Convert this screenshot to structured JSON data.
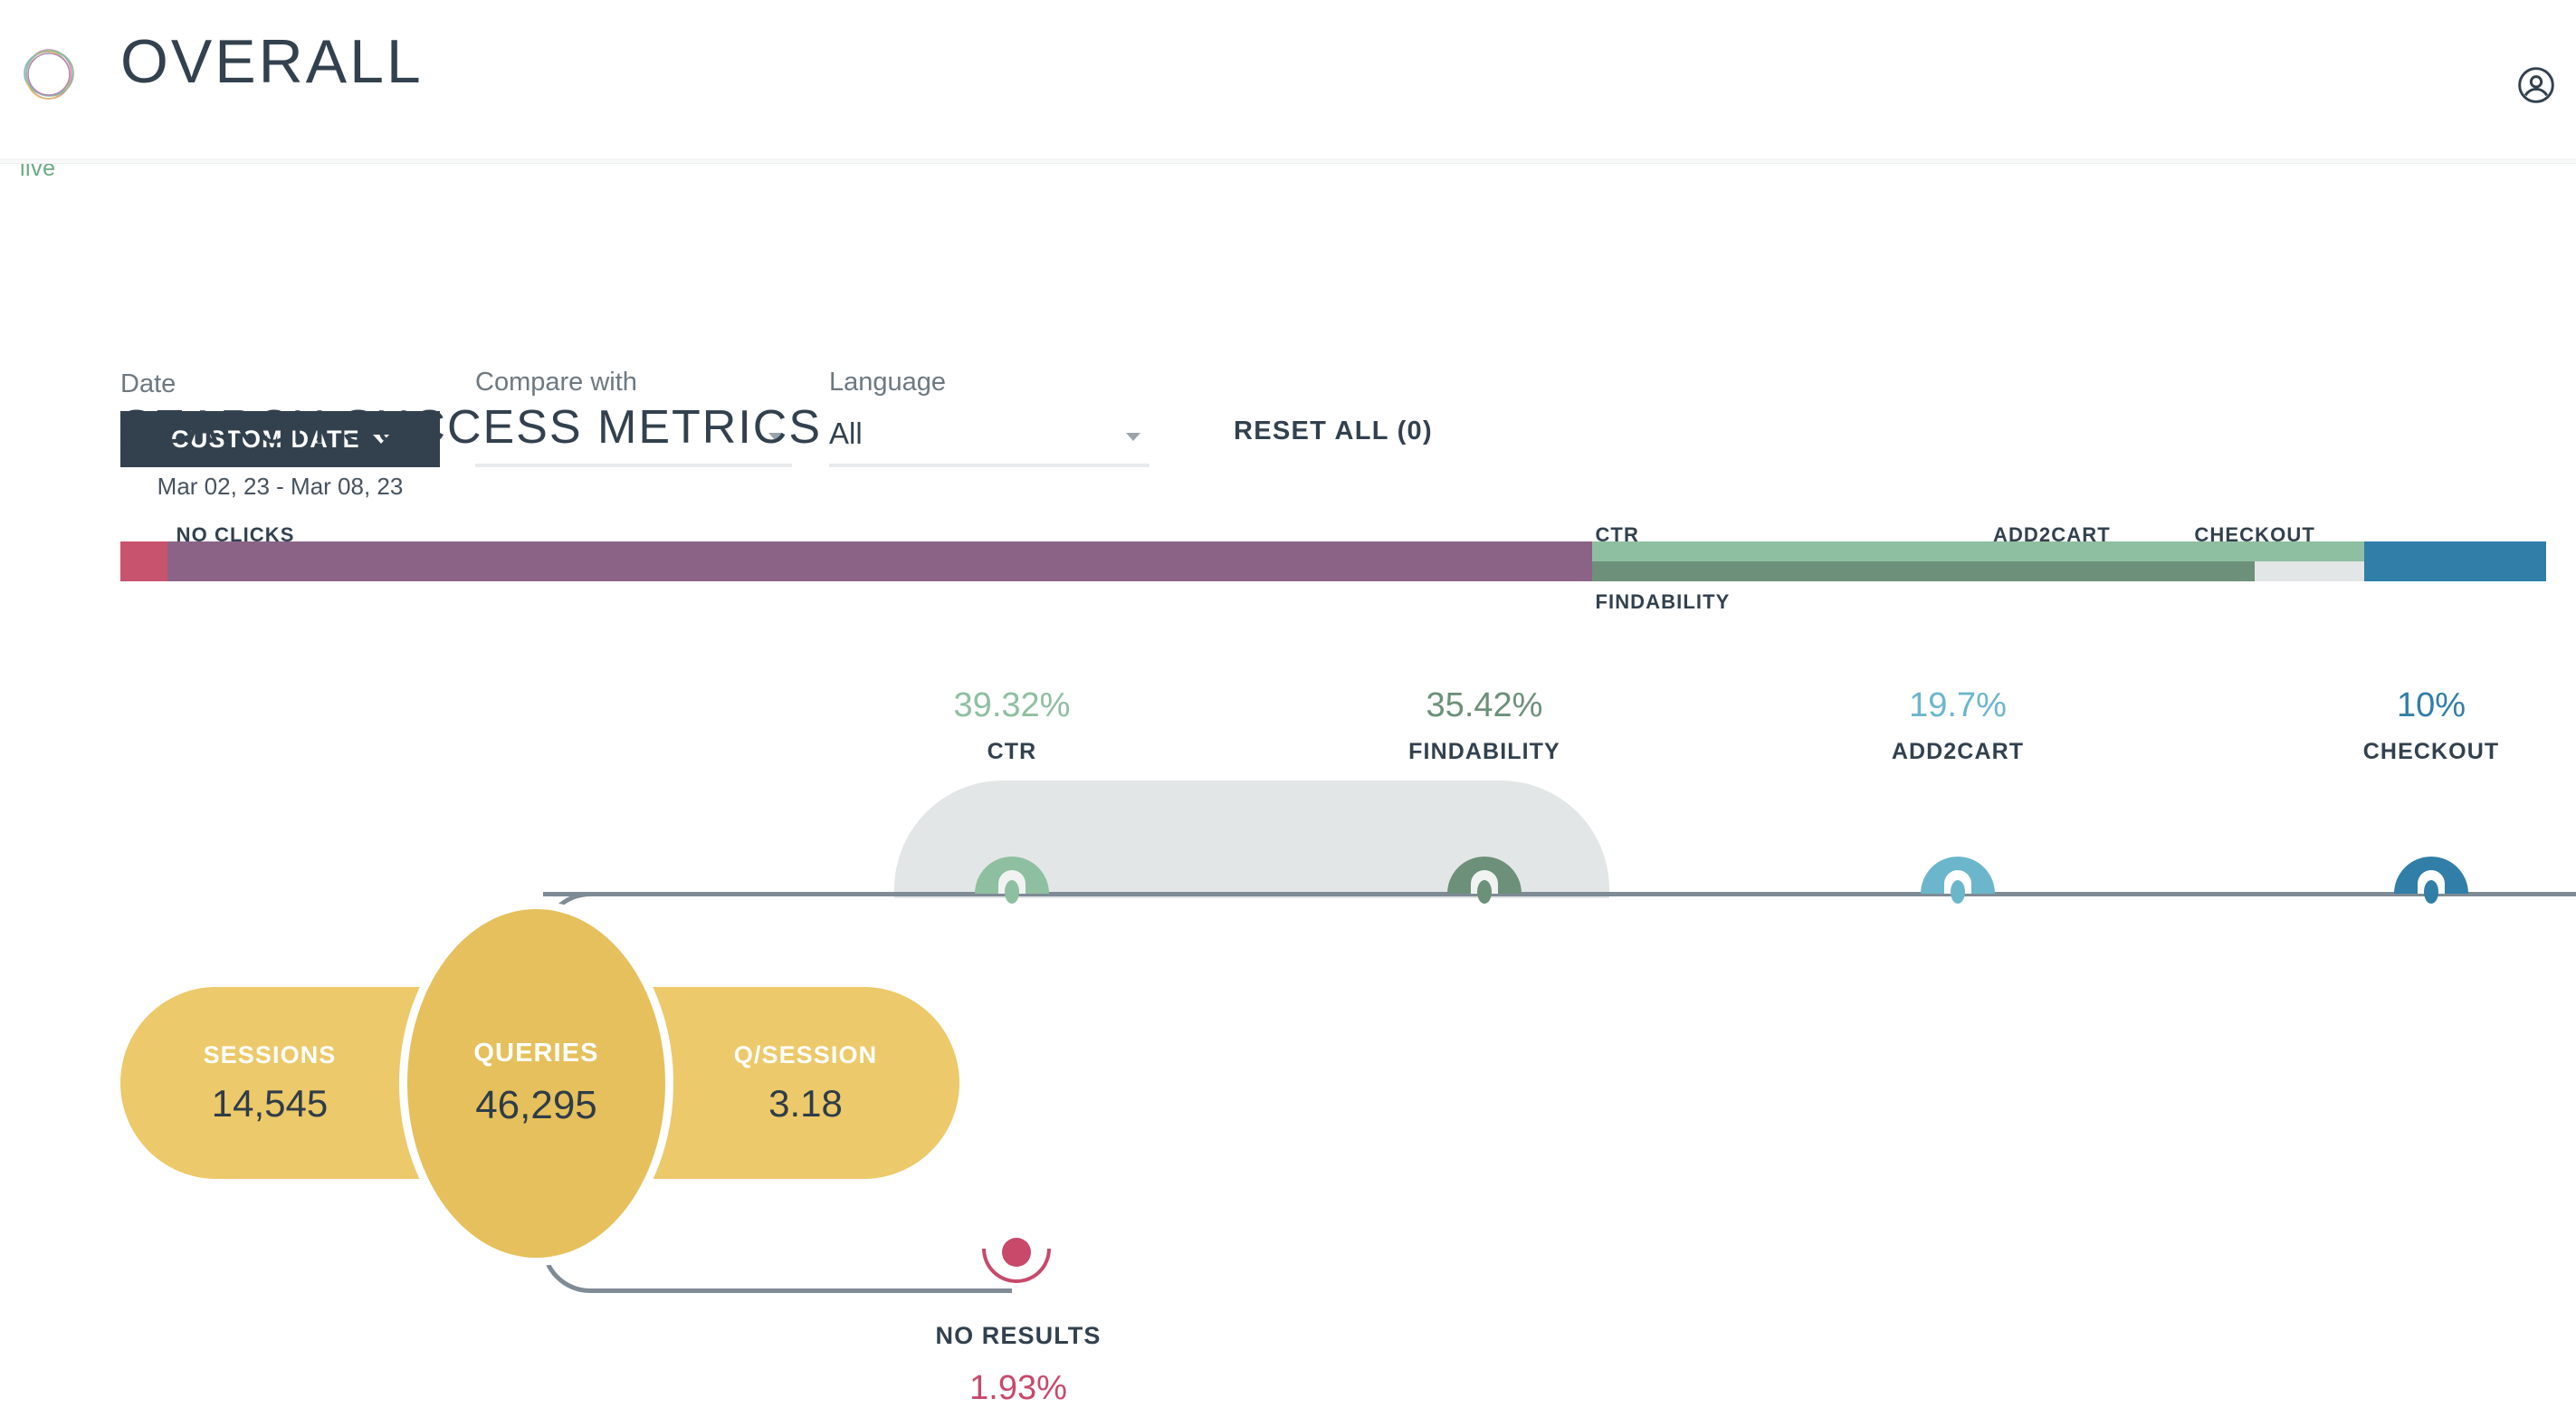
{
  "header": {
    "title": "OVERALL",
    "live_badge": "live",
    "logo_icon": "concentric-circles-logo",
    "account_icon": "account-circle-icon"
  },
  "filters": {
    "date": {
      "label": "Date",
      "button_label": "CUSTOM DATE",
      "caret_icon": "chevron-down-icon",
      "range": "Mar 02, 23 - Mar 08, 23"
    },
    "compare": {
      "label": "Compare with",
      "value": "",
      "caret_icon": "chevron-down-icon"
    },
    "language": {
      "label": "Language",
      "value": "All",
      "caret_icon": "chevron-down-icon"
    },
    "reset_all": "RESET ALL (0)"
  },
  "section": {
    "title": "SEARCH SUCCESS METRICS"
  },
  "chart_data": {
    "type": "bar",
    "title": "SEARCH SUCCESS METRICS",
    "subtype": "stacked-horizontal-funnel",
    "bar_segments": [
      {
        "name": "NO RESULTS",
        "label": "",
        "color": "#c8536e",
        "start_pct": 0.0,
        "end_pct": 1.93,
        "row": "full"
      },
      {
        "name": "NO CLICKS",
        "label": "NO CLICKS",
        "color": "#8b6387",
        "start_pct": 1.93,
        "end_pct": 60.68,
        "row": "full"
      },
      {
        "name": "CTR",
        "label": "CTR",
        "color": "#8fbfa1",
        "start_pct": 60.68,
        "end_pct": 100.0,
        "row": "top"
      },
      {
        "name": "FINDABILITY",
        "label": "FINDABILITY",
        "color": "#6c9079",
        "start_pct": 60.68,
        "end_pct": 88.0,
        "row": "bottom"
      },
      {
        "name": "GAP",
        "label": "",
        "color": "#e2e6e6",
        "start_pct": 88.0,
        "end_pct": 92.5,
        "row": "bottom"
      },
      {
        "name": "ADD2CART",
        "label": "ADD2CART",
        "color": "#6cb6cc",
        "start_pct": 92.5,
        "end_pct": 100.0,
        "row": "full"
      },
      {
        "name": "CHECKOUT",
        "label": "CHECKOUT",
        "color": "#317ea8",
        "start_pct": 92.5,
        "end_pct": 100.0,
        "row": "full"
      }
    ],
    "bar_labels": [
      {
        "text": "NO CLICKS",
        "x_pct": 2.3
      },
      {
        "text": "CTR",
        "x_pct": 60.8
      },
      {
        "text": "FINDABILITY",
        "x_pct": 60.8
      },
      {
        "text": "ADD2CART",
        "x_pct": 77.2
      },
      {
        "text": "CHECKOUT",
        "x_pct": 85.5
      }
    ],
    "kpis": [
      {
        "name": "CTR",
        "value": "39.32%",
        "numeric": 39.32,
        "color": "#8fbfa1"
      },
      {
        "name": "FINDABILITY",
        "value": "35.42%",
        "numeric": 35.42,
        "color": "#6c9079"
      },
      {
        "name": "ADD2CART",
        "value": "19.7%",
        "numeric": 19.7,
        "color": "#6cb6cc"
      },
      {
        "name": "CHECKOUT",
        "value": "10%",
        "numeric": 10,
        "color": "#317ea8"
      }
    ],
    "volume_metrics": [
      {
        "name": "SESSIONS",
        "value": "14,545"
      },
      {
        "name": "QUERIES",
        "value": "46,295"
      },
      {
        "name": "Q/SESSION",
        "value": "3.18"
      }
    ],
    "no_results": {
      "name": "NO RESULTS",
      "value": "1.93%",
      "numeric": 1.93,
      "color": "#c8496a"
    },
    "xlabel": "",
    "ylabel": "",
    "grid": false,
    "legend": "inline-labels"
  }
}
